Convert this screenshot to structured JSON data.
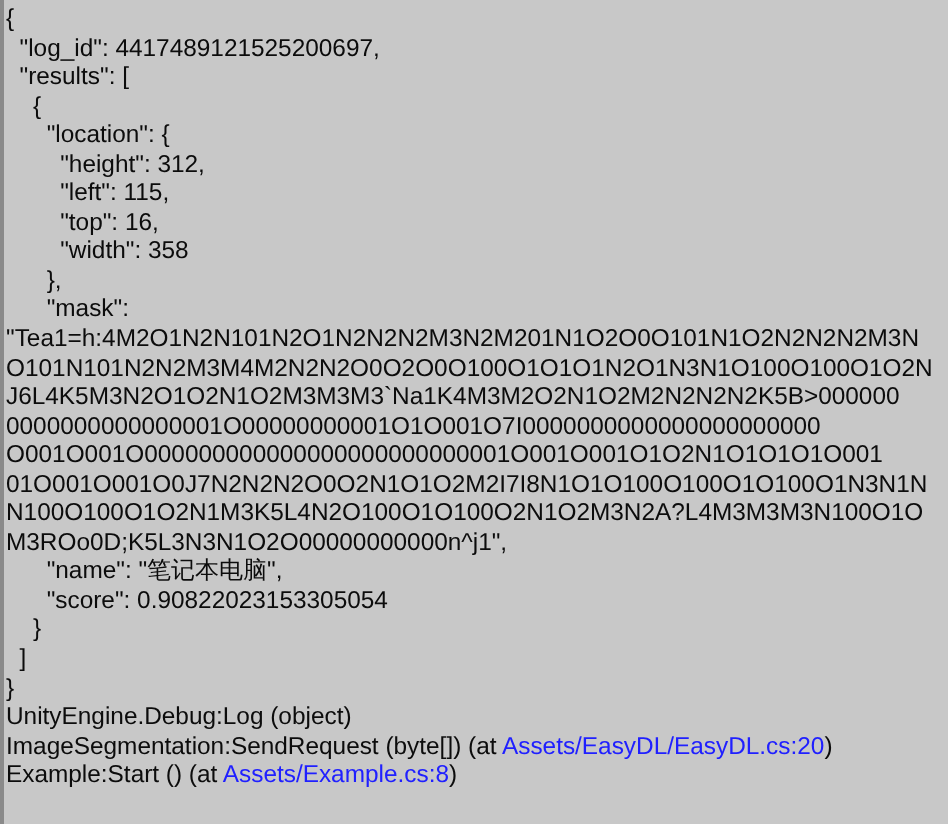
{
  "log_lines": [
    "{",
    "  \"log_id\": 4417489121525200697,",
    "  \"results\": [",
    "    {",
    "      \"location\": {",
    "        \"height\": 312,",
    "        \"left\": 115,",
    "        \"top\": 16,",
    "        \"width\": 358",
    "      },",
    "      \"mask\":",
    "\"Tea1=h:4M2O1N2N101N2O1N2N2N2M3N2M201N1O2O0O101N1O2N2N2N2M3N",
    "O101N101N2N2M3M4M2N2N2O0O2O0O100O1O1O1N2O1N3N1O100O100O1O2N",
    "J6L4K5M3N2O1O2N1O2M3M3M3`Na1K4M3M2O2N1O2M2N2N2N2K5B>000000",
    "0000000000000001O00000000001O1O001O7I0000000000000000000000",
    "O001O001O000000000000000000000000001O001O001O1O2N1O1O1O1O001",
    "01O001O001O0J7N2N2N2O0O2N1O1O2M2I7I8N1O1O100O100O1O100O1N3N1N",
    "N100O100O1O2N1M3K5L4N2O100O1O100O2N1O2M3N2A?L4M3M3M3N100O1O",
    "M3ROo0D;K5L3N3N1O2O00000000000n^j1\",",
    "      \"name\": \"笔记本电脑\",",
    "      \"score\": 0.90822023153305054",
    "    }",
    "  ]",
    "}"
  ],
  "stack_trace": [
    {
      "text": "UnityEngine.Debug:Log (object)"
    },
    {
      "text": "ImageSegmentation:SendRequest (byte[]) (at ",
      "link": "Assets/EasyDL/EasyDL.cs:20",
      "after": ")"
    },
    {
      "text": "Example:Start () (at ",
      "link": "Assets/Example.cs:8",
      "after": ")"
    }
  ]
}
